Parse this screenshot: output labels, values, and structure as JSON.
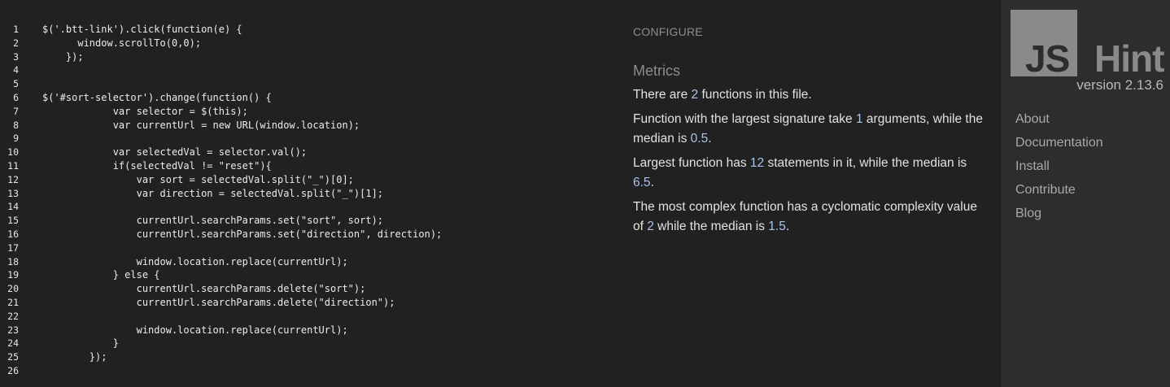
{
  "editor": {
    "lines": [
      {
        "n": "1",
        "indent": "",
        "text": "$('.btt-link').click(function(e) {"
      },
      {
        "n": "2",
        "indent": "      ",
        "text": "window.scrollTo(0,0);"
      },
      {
        "n": "3",
        "indent": "    ",
        "text": "});"
      },
      {
        "n": "4",
        "indent": "",
        "text": ""
      },
      {
        "n": "5",
        "indent": "",
        "text": ""
      },
      {
        "n": "6",
        "indent": "",
        "text": "$('#sort-selector').change(function() {"
      },
      {
        "n": "7",
        "indent": "            ",
        "text": "var selector = $(this);"
      },
      {
        "n": "8",
        "indent": "            ",
        "text": "var currentUrl = new URL(window.location);"
      },
      {
        "n": "9",
        "indent": "",
        "text": ""
      },
      {
        "n": "10",
        "indent": "            ",
        "text": "var selectedVal = selector.val();"
      },
      {
        "n": "11",
        "indent": "            ",
        "text": "if(selectedVal != \"reset\"){"
      },
      {
        "n": "12",
        "indent": "                ",
        "text": "var sort = selectedVal.split(\"_\")[0];"
      },
      {
        "n": "13",
        "indent": "                ",
        "text": "var direction = selectedVal.split(\"_\")[1];"
      },
      {
        "n": "14",
        "indent": "",
        "text": ""
      },
      {
        "n": "15",
        "indent": "                ",
        "text": "currentUrl.searchParams.set(\"sort\", sort);"
      },
      {
        "n": "16",
        "indent": "                ",
        "text": "currentUrl.searchParams.set(\"direction\", direction);"
      },
      {
        "n": "17",
        "indent": "",
        "text": ""
      },
      {
        "n": "18",
        "indent": "                ",
        "text": "window.location.replace(currentUrl);"
      },
      {
        "n": "19",
        "indent": "            ",
        "text": "} else {"
      },
      {
        "n": "20",
        "indent": "                ",
        "text": "currentUrl.searchParams.delete(\"sort\");"
      },
      {
        "n": "21",
        "indent": "                ",
        "text": "currentUrl.searchParams.delete(\"direction\");"
      },
      {
        "n": "22",
        "indent": "",
        "text": ""
      },
      {
        "n": "23",
        "indent": "                ",
        "text": "window.location.replace(currentUrl);"
      },
      {
        "n": "24",
        "indent": "            ",
        "text": "}"
      },
      {
        "n": "25",
        "indent": "        ",
        "text": "});"
      },
      {
        "n": "26",
        "indent": "",
        "text": ""
      }
    ]
  },
  "report": {
    "configure_label": "CONFIGURE",
    "metrics_title": "Metrics",
    "functions_count": "2",
    "largest_signature_args": "1",
    "signature_median": "0.5",
    "largest_statements": "12",
    "statements_median": "6.5",
    "complexity_value": "2",
    "complexity_median": "1.5",
    "text": {
      "m1_a": "There are ",
      "m1_b": " functions in this file.",
      "m2_a": "Function with the largest signature take ",
      "m2_b": " arguments, while the median is ",
      "m2_c": ".",
      "m3_a": "Largest function has ",
      "m3_b": " statements in it, while the median is ",
      "m3_c": ".",
      "m4_a": "The most complex function has a cyclomatic complexity value of ",
      "m4_b": " while the median is ",
      "m4_c": "."
    }
  },
  "sidebar": {
    "logo_js": "JS",
    "logo_hint": "Hint",
    "version": "version 2.13.6",
    "nav": [
      "About",
      "Documentation",
      "Install",
      "Contribute",
      "Blog"
    ]
  },
  "colors": {
    "background": "#212121",
    "sidebar": "#2d2d2d",
    "number_highlight": "#a9c4e8",
    "logo_grey": "#8a8a8a"
  }
}
